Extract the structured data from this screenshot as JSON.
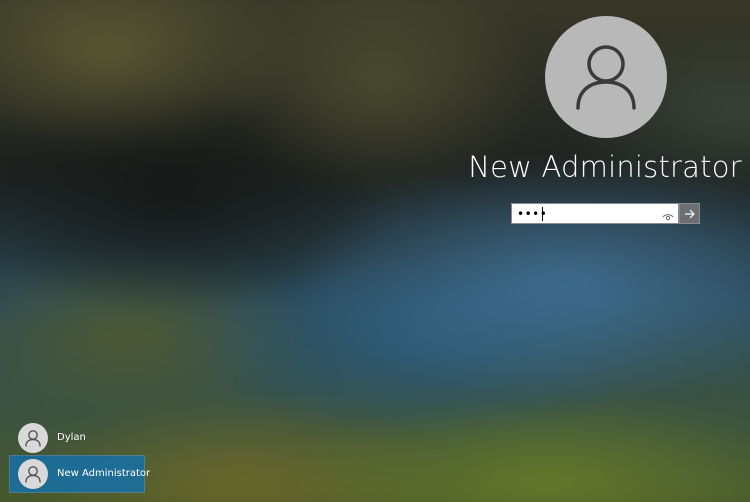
{
  "lock_screen": {
    "selected_user": {
      "name": "New Administrator",
      "avatar_icon": "user-icon"
    },
    "password_field": {
      "value": "••••",
      "reveal_icon": "eye-icon"
    },
    "submit_icon": "arrow-right-icon",
    "user_list": [
      {
        "label": "Dylan",
        "icon": "user-icon",
        "selected": false
      },
      {
        "label": "New Administrator",
        "icon": "user-icon",
        "selected": true
      }
    ]
  },
  "colors": {
    "selected_item_bg": "#1a6ea0",
    "avatar_bg": "#b8b8b8",
    "text": "#ffffff"
  }
}
